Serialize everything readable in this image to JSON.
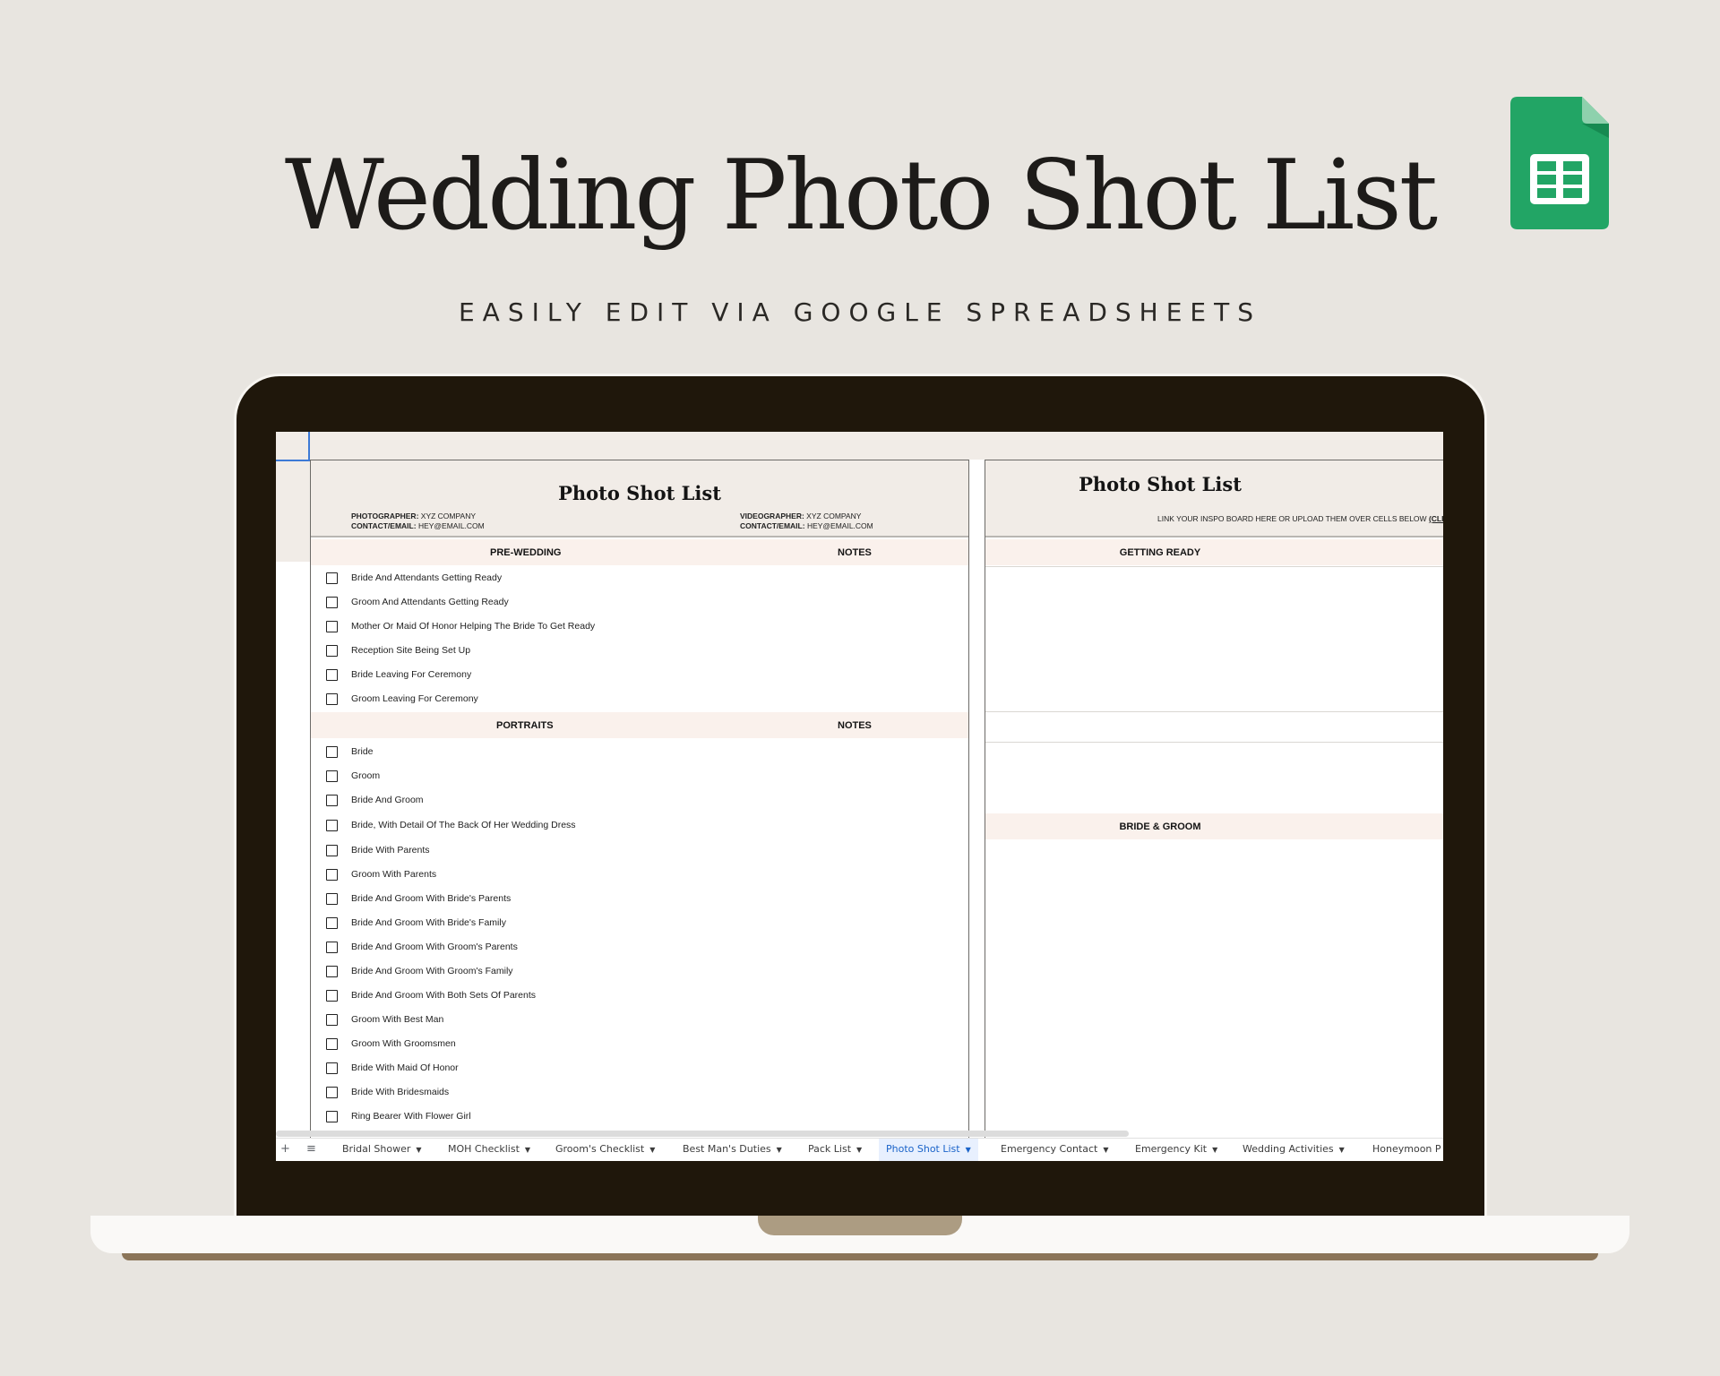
{
  "hero": {
    "title": "Wedding Photo Shot List",
    "subtitle": "EASILY EDIT VIA GOOGLE SPREADSHEETS"
  },
  "colors": {
    "background": "#e8e5e0",
    "sheets_green": "#22a565",
    "accent_blue": "#1a63c9"
  },
  "left_panel": {
    "title": "Photo Shot List",
    "photographer_label": "PHOTOGRAPHER:",
    "photographer_value": "XYZ COMPANY",
    "contact_label": "CONTACT/EMAIL:",
    "contact_value": "HEY@EMAIL.COM",
    "videographer_label": "VIDEOGRAPHER:",
    "videographer_value": "XYZ COMPANY",
    "contact2_label": "CONTACT/EMAIL:",
    "contact2_value": "HEY@EMAIL.COM",
    "sections": [
      {
        "label": "PRE-WEDDING",
        "notes_label": "NOTES",
        "items": [
          "Bride And Attendants Getting Ready",
          "Groom And Attendants Getting Ready",
          "Mother Or Maid Of Honor Helping The Bride To Get Ready",
          "Reception Site Being Set Up",
          "Bride Leaving For Ceremony",
          "Groom Leaving For Ceremony"
        ]
      },
      {
        "label": "PORTRAITS",
        "notes_label": "NOTES",
        "items": [
          "Bride",
          "Groom",
          "Bride And Groom",
          "Bride, With Detail Of The Back Of Her Wedding Dress",
          "Bride With Parents",
          "Groom With Parents",
          "Bride And Groom With Bride's Parents",
          "Bride And Groom With Bride's Family",
          "Bride And Groom With Groom's Parents",
          "Bride And Groom With Groom's Family",
          "Bride And Groom With Both Sets Of Parents",
          "Groom With Best Man",
          "Groom With Groomsmen",
          "Bride With Maid Of Honor",
          "Bride With Bridesmaids",
          "Ring Bearer With Flower Girl"
        ]
      }
    ]
  },
  "right_panel": {
    "title": "Photo Shot List",
    "instructions": "LINK YOUR INSPO BOARD HERE OR UPLOAD THEM OVER CELLS BELOW",
    "instructions_link": "(CLICK",
    "sections": [
      "GETTING READY",
      "BRIDE & GROOM"
    ]
  },
  "tabs": {
    "add_icon": "+",
    "menu_icon": "≡",
    "items": [
      {
        "label": "Bridal Shower",
        "active": false
      },
      {
        "label": "MOH Checklist",
        "active": false
      },
      {
        "label": "Groom's Checklist",
        "active": false
      },
      {
        "label": "Best Man's Duties",
        "active": false
      },
      {
        "label": "Pack List",
        "active": false
      },
      {
        "label": "Photo Shot List",
        "active": true
      },
      {
        "label": "Emergency Contact",
        "active": false
      },
      {
        "label": "Emergency Kit",
        "active": false
      },
      {
        "label": "Wedding Activities",
        "active": false
      },
      {
        "label": "Honeymoon P",
        "active": false
      }
    ]
  }
}
